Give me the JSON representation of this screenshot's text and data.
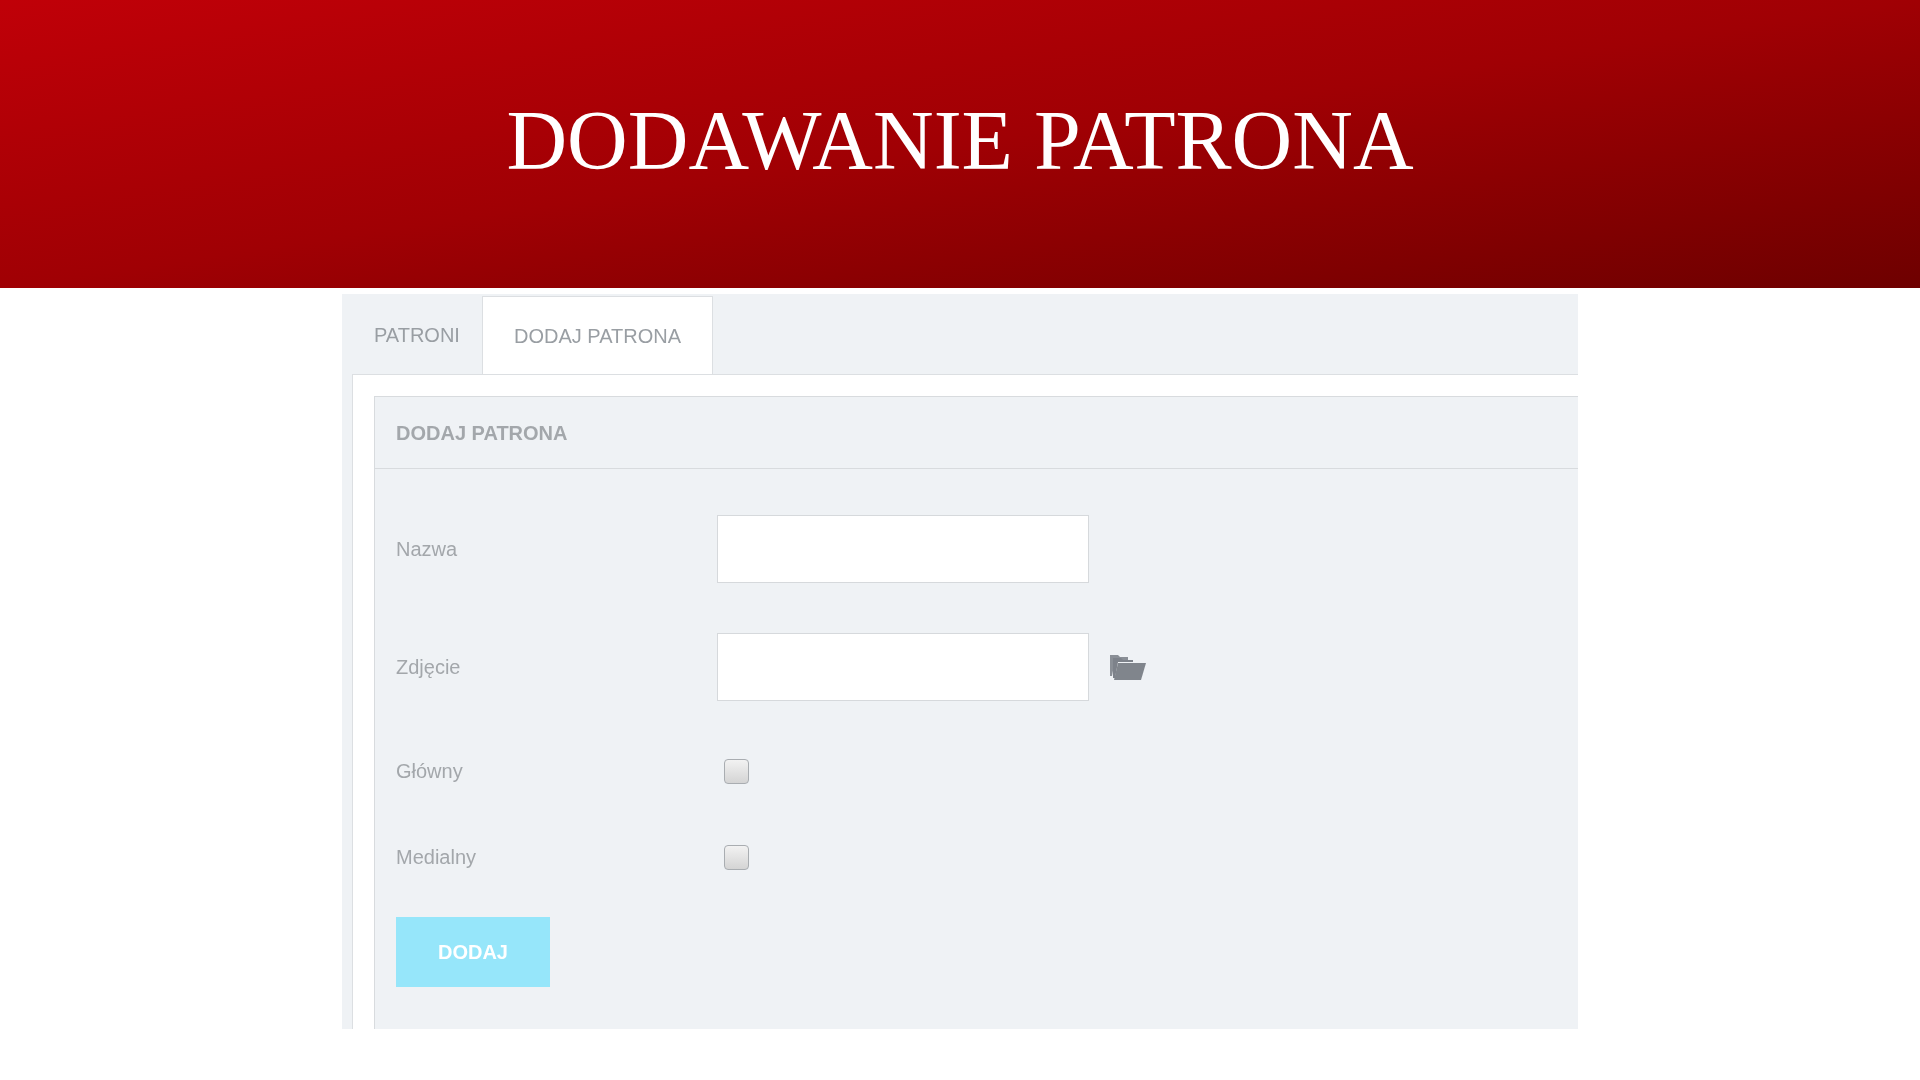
{
  "slide_title": "DODAWANIE PATRONA",
  "tabs": [
    {
      "label": "PATRONI",
      "selected": false
    },
    {
      "label": "DODAJ PATRONA",
      "selected": true
    }
  ],
  "panel": {
    "title": "DODAJ PATRONA"
  },
  "fields": [
    {
      "kind": "text",
      "label": "Nazwa"
    },
    {
      "kind": "file",
      "label": "Zdjęcie"
    },
    {
      "kind": "checkbox",
      "label": "Główny",
      "checked": false
    },
    {
      "kind": "checkbox",
      "label": "Medialny",
      "checked": false
    }
  ],
  "submit_button": "DODAJ"
}
